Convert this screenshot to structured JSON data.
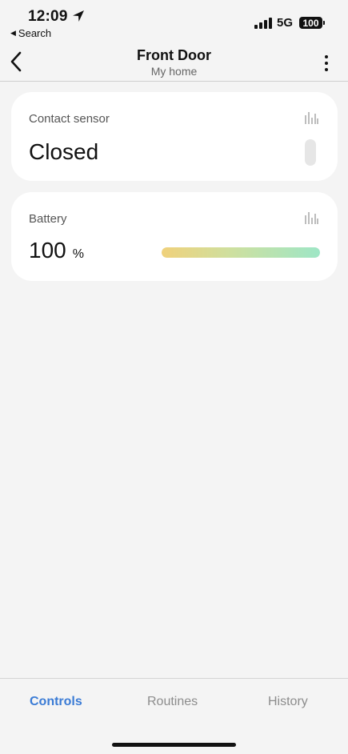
{
  "status_bar": {
    "time": "12:09",
    "back_app": "Search",
    "network": "5G",
    "battery": "100"
  },
  "header": {
    "title": "Front Door",
    "subtitle": "My home"
  },
  "cards": {
    "contact": {
      "label": "Contact sensor",
      "value": "Closed"
    },
    "battery": {
      "label": "Battery",
      "value": "100",
      "unit": "%",
      "level_percent": 100
    }
  },
  "tabs": [
    {
      "label": "Controls",
      "active": true
    },
    {
      "label": "Routines",
      "active": false
    },
    {
      "label": "History",
      "active": false
    }
  ],
  "colors": {
    "accent": "#3a7bd5",
    "background": "#f4f4f4",
    "card": "#ffffff",
    "battery_gradient_start": "#f0d17b",
    "battery_gradient_end": "#9ee6c6"
  }
}
